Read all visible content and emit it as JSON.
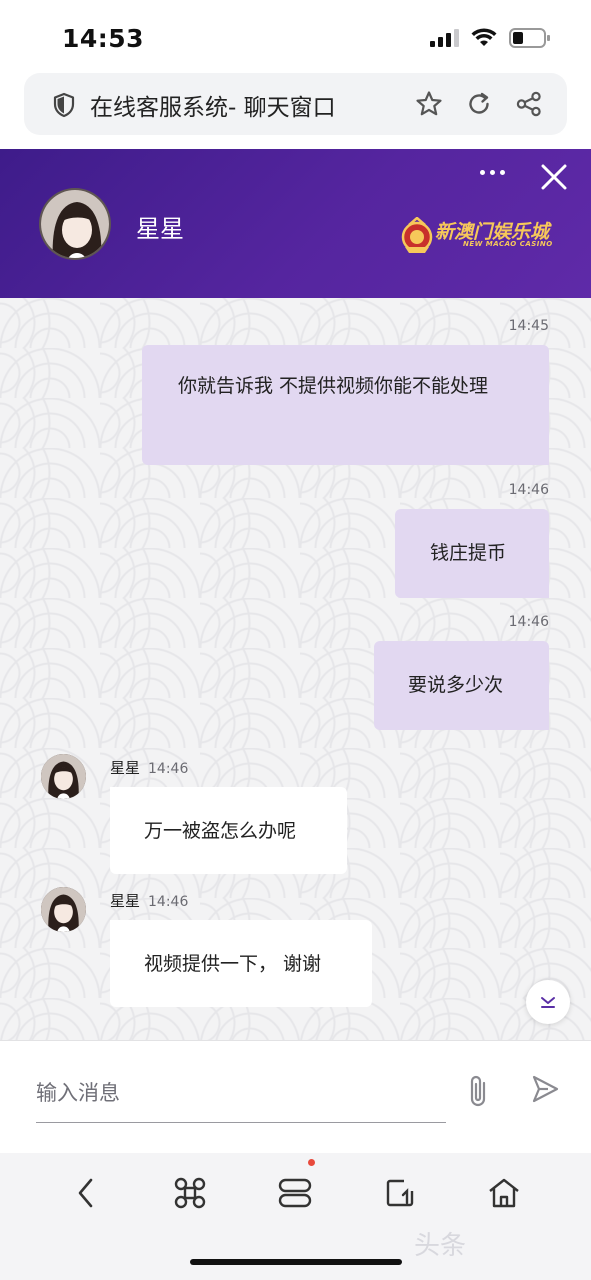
{
  "status_bar": {
    "time": "14:53"
  },
  "browser": {
    "page_title": "在线客服系统- 聊天窗口"
  },
  "header": {
    "agent_name": "星星",
    "brand_name": "新澳门娱乐城",
    "brand_subtitle": "NEW MACAO CASINO",
    "accent_color": "#4b2196"
  },
  "messages": {
    "out": [
      {
        "time": "14:45",
        "text": "你就告诉我 不提供视频你能不能处理"
      },
      {
        "time": "14:46",
        "text": "钱庄提币"
      },
      {
        "time": "14:46",
        "text": "要说多少次"
      }
    ],
    "in": [
      {
        "sender": "星星",
        "time": "14:46",
        "text": "万一被盗怎么办呢"
      },
      {
        "sender": "星星",
        "time": "14:46",
        "text": "视频提供一下， 谢谢"
      }
    ]
  },
  "composer": {
    "placeholder": "输入消息"
  },
  "icons": {
    "url_bar": [
      "shield-icon",
      "star-icon",
      "reload-icon",
      "share-icon"
    ],
    "header": [
      "more-icon",
      "close-icon"
    ],
    "composer": [
      "paperclip-icon",
      "send-icon"
    ],
    "bottom_nav": [
      "back-icon",
      "command-icon",
      "tabs-icon",
      "tab-switch-icon",
      "home-icon"
    ]
  },
  "watermark": "头条"
}
